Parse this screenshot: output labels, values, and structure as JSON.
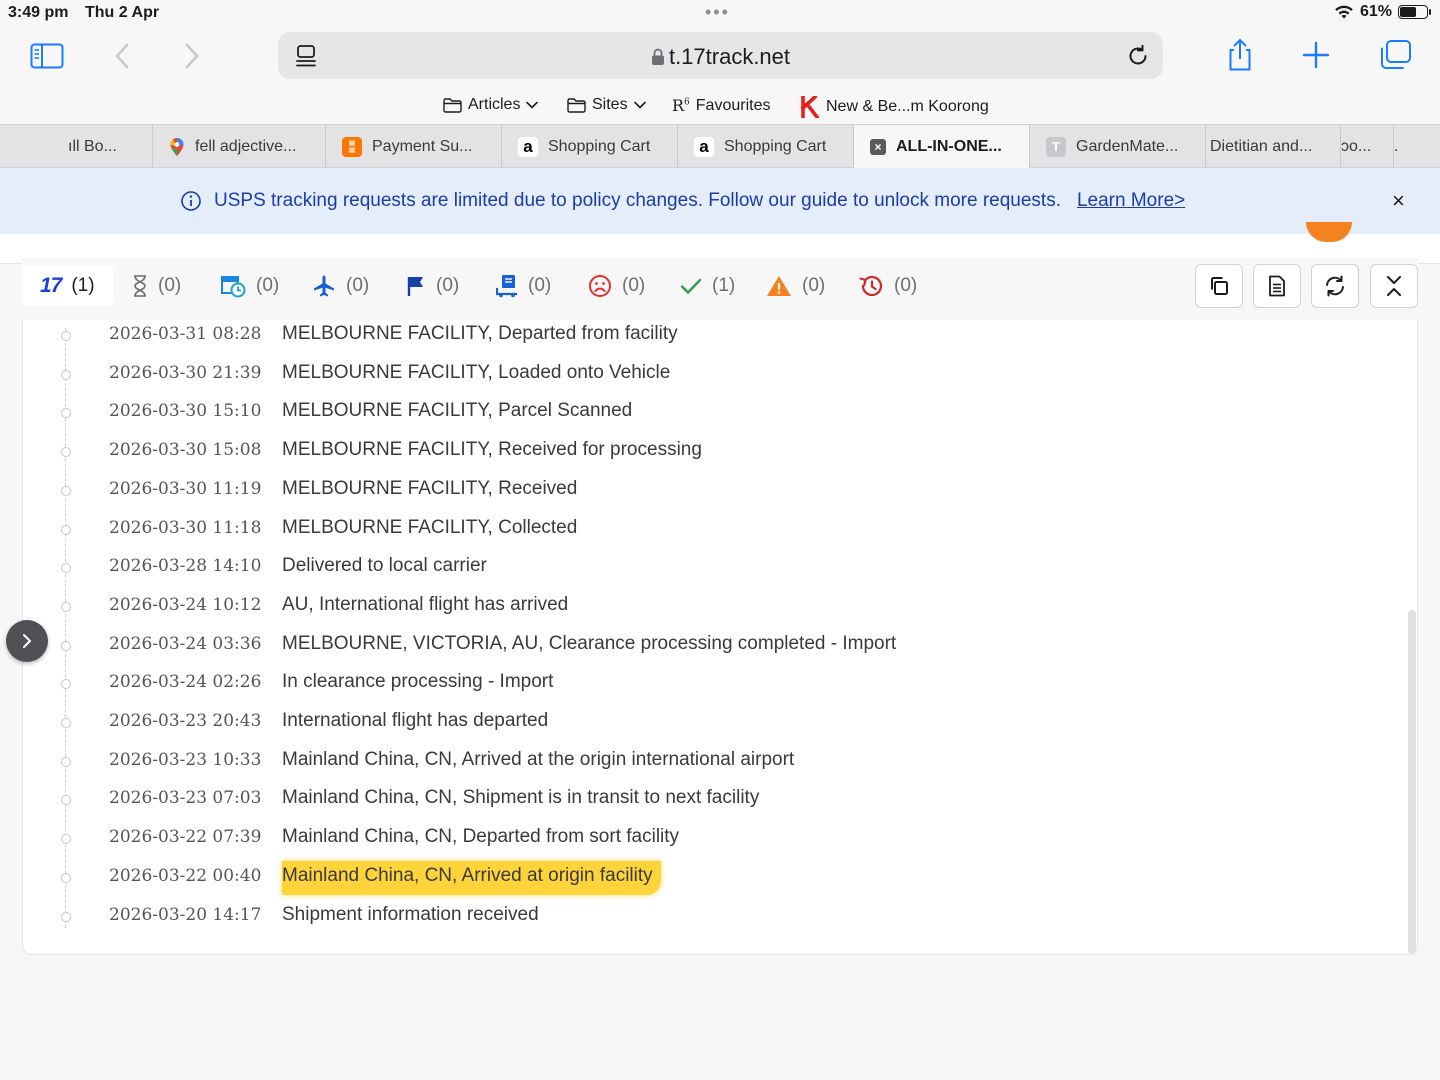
{
  "status_bar": {
    "time": "3:49 pm",
    "date": "Thu 2 Apr",
    "battery": "61%",
    "battery_level": 0.61
  },
  "toolbar": {
    "url": "t.17track.net"
  },
  "bookmarks": [
    {
      "label": "Articles",
      "icon": "folder-icon"
    },
    {
      "label": "Sites",
      "icon": "folder-icon"
    },
    {
      "label": "Favourites",
      "icon": "r6-icon"
    },
    {
      "label": "New & Be...m Koorong",
      "icon": "k-icon"
    }
  ],
  "tabs": [
    {
      "label": "ıll Bo...",
      "active": false
    },
    {
      "label": "fell adjective...",
      "active": false
    },
    {
      "label": "Payment Su...",
      "active": false
    },
    {
      "label": "Shopping Cart",
      "active": false
    },
    {
      "label": "Shopping Cart",
      "active": false
    },
    {
      "label": "ALL-IN-ONE...",
      "active": true
    },
    {
      "label": "GardenMate...",
      "active": false
    },
    {
      "label": "Dietitian and...",
      "active": false
    },
    {
      "label": "ɔo...",
      "active": false
    },
    {
      "label": ".",
      "active": false
    }
  ],
  "banner": {
    "message": "USPS tracking requests are limited due to policy changes. Follow our guide to unlock more requests.",
    "link": "Learn More>",
    "close": "×"
  },
  "filters": [
    {
      "count": "(1)",
      "icon": "17track-logo-icon",
      "active": true
    },
    {
      "count": "(0)",
      "icon": "hourglass-icon"
    },
    {
      "count": "(0)",
      "icon": "pickup-icon"
    },
    {
      "count": "(0)",
      "icon": "plane-icon"
    },
    {
      "count": "(0)",
      "icon": "flag-icon"
    },
    {
      "count": "(0)",
      "icon": "delivery-icon"
    },
    {
      "count": "(0)",
      "icon": "sad-face-icon"
    },
    {
      "count": "(1)",
      "icon": "check-icon"
    },
    {
      "count": "(0)",
      "icon": "warning-icon"
    },
    {
      "count": "(0)",
      "icon": "history-icon"
    }
  ],
  "events": [
    {
      "time": "2026-03-31 08:28",
      "text": "MELBOURNE FACILITY, Departed from facility"
    },
    {
      "time": "2026-03-30 21:39",
      "text": "MELBOURNE FACILITY, Loaded onto Vehicle"
    },
    {
      "time": "2026-03-30 15:10",
      "text": "MELBOURNE FACILITY, Parcel Scanned"
    },
    {
      "time": "2026-03-30 15:08",
      "text": "MELBOURNE FACILITY, Received for processing"
    },
    {
      "time": "2026-03-30 11:19",
      "text": "MELBOURNE FACILITY, Received"
    },
    {
      "time": "2026-03-30 11:18",
      "text": "MELBOURNE FACILITY, Collected"
    },
    {
      "time": "2026-03-28 14:10",
      "text": "Delivered to local carrier"
    },
    {
      "time": "2026-03-24 10:12",
      "text": "AU, International flight has arrived"
    },
    {
      "time": "2026-03-24 03:36",
      "text": "MELBOURNE, VICTORIA, AU, Clearance processing completed - Import"
    },
    {
      "time": "2026-03-24 02:26",
      "text": "In clearance processing - Import"
    },
    {
      "time": "2026-03-23 20:43",
      "text": "International flight has departed"
    },
    {
      "time": "2026-03-23 10:33",
      "text": "Mainland China, CN, Arrived at the origin international airport"
    },
    {
      "time": "2026-03-23 07:03",
      "text": "Mainland China, CN, Shipment is in transit to next facility"
    },
    {
      "time": "2026-03-22 07:39",
      "text": "Mainland China, CN, Departed from sort facility"
    },
    {
      "time": "2026-03-22 00:40",
      "text": "Mainland China, CN, Arrived at origin facility",
      "highlighted": true
    },
    {
      "time": "2026-03-20 14:17",
      "text": "Shipment information received"
    }
  ],
  "colors": {
    "accent": "#1a7cff",
    "banner_text": "#1b3da8",
    "highlight": "#ffd43b",
    "warning": "#f58220"
  }
}
